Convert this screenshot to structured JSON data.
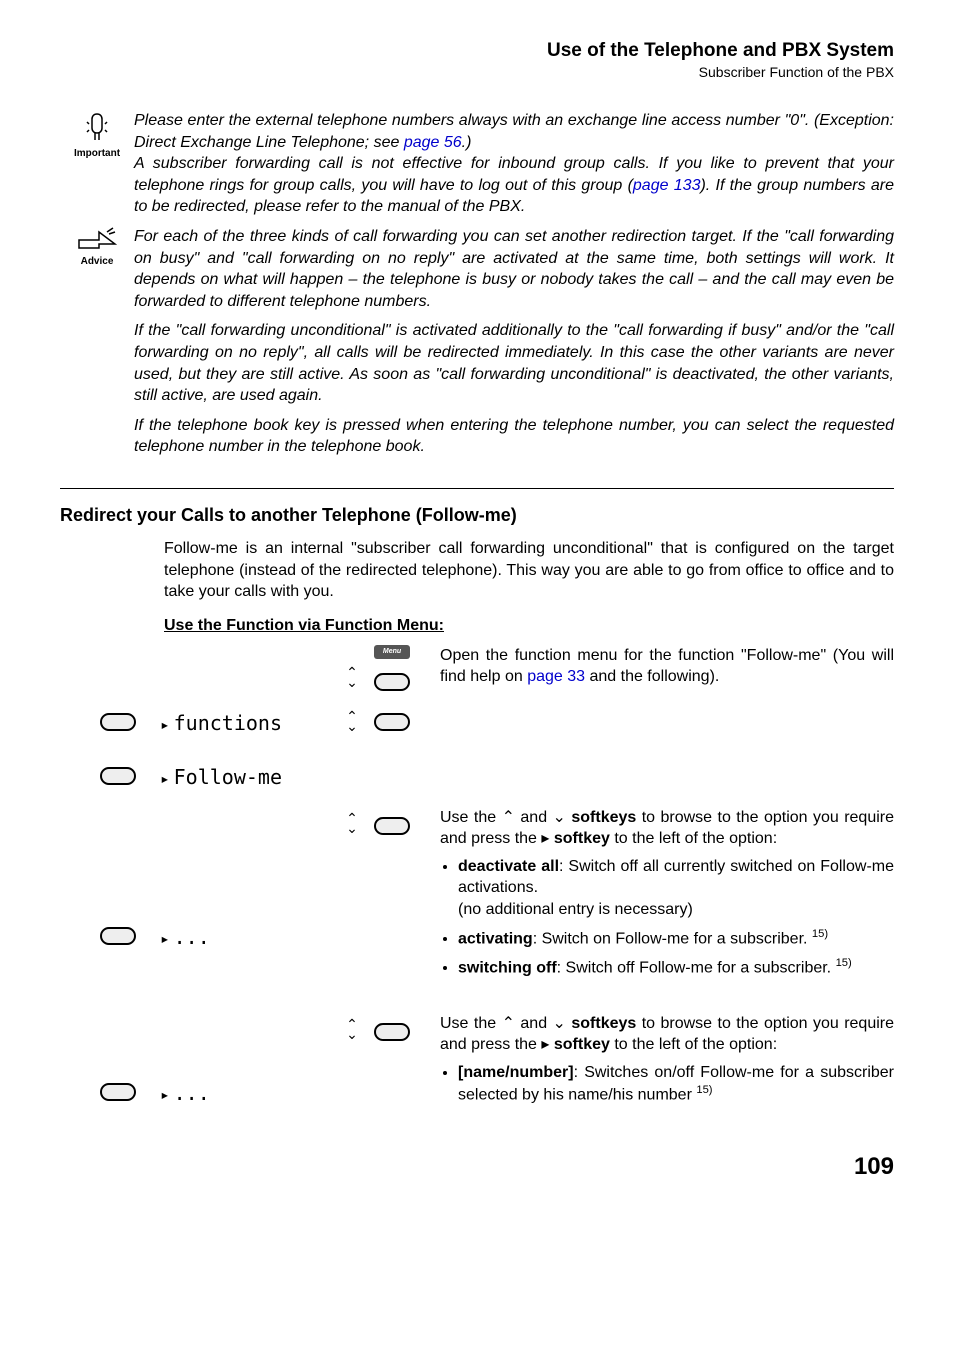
{
  "header": {
    "title": "Use of the Telephone and PBX System",
    "subtitle": "Subscriber Function of the PBX"
  },
  "notes": {
    "important_label": "Important",
    "advice_label": "Advice",
    "important_p1_a": "Please enter the external telephone numbers always with an exchange line access number \"0\". (Exception: Direct Exchange Line Telephone; see ",
    "important_p1_link": "page 56",
    "important_p1_b": ".)",
    "important_p2_a": "A subscriber forwarding call is not effective for inbound group calls. If you like to prevent that your telephone rings for group calls, you will have to log out of this group (",
    "important_p2_link": "page 133",
    "important_p2_b": "). If the group numbers are to be redirected, please refer to the manual of the PBX.",
    "advice_p1": "For each of the three kinds of call forwarding you can set another redirection target. If the \"call forwarding on busy\" and \"call forwarding on no reply\" are activated at the same time, both settings will work. It depends on what will happen – the telephone is busy or nobody takes the call – and the call may even be forwarded to different telephone numbers.",
    "advice_p2": "If the \"call forwarding unconditional\" is activated additionally to the \"call forwarding if busy\" and/or the \"call forwarding on no reply\", all calls will be redirected immediately. In this case the other variants are never used, but they are still active. As soon as \"call forwarding unconditional\" is deactivated, the other variants, still active, are used again.",
    "advice_p3": "If the telephone book key is pressed when entering the telephone number, you can select the requested telephone number in the telephone book."
  },
  "section": {
    "heading": "Redirect your Calls to another Telephone (Follow-me)",
    "intro": "Follow-me is an internal \"subscriber call forwarding unconditional\" that is configured on the target telephone (instead of the redirected telephone). This way you are able to go from office to office and to take your calls with you.",
    "subheading": "Use the Function via Function Menu:"
  },
  "menu_steps": {
    "menu_key_label": "Menu",
    "functions_label": "functions",
    "followme_label": "Follow-me",
    "ellipsis": "...",
    "step1_a": "Open the function menu for the function \"Follow-me\" (You will find help on ",
    "step1_link": "page 33",
    "step1_b": " and the following).",
    "browse_a": "Use the ",
    "browse_b": " and ",
    "browse_c": " softkeys",
    "browse_d": " to browse to the option you require and press the ",
    "browse_e": " softkey",
    "browse_f": " to the left of the option:",
    "opt_deact_label": "deactivate all",
    "opt_deact_text": ": Switch off all currently switched on Follow-me activations.",
    "opt_deact_note": "(no additional entry is necessary)",
    "opt_act_label": "activating",
    "opt_act_text": ": Switch on Follow-me for a subscriber.",
    "opt_sw_label": "switching off",
    "opt_sw_text": ": Switch off Follow-me for a subscriber.",
    "opt_name_label": "[name/number]",
    "opt_name_text": ": Switches on/off Follow-me for a subscriber selected by his name/his number",
    "footnote": "15)"
  },
  "page_number": "109"
}
